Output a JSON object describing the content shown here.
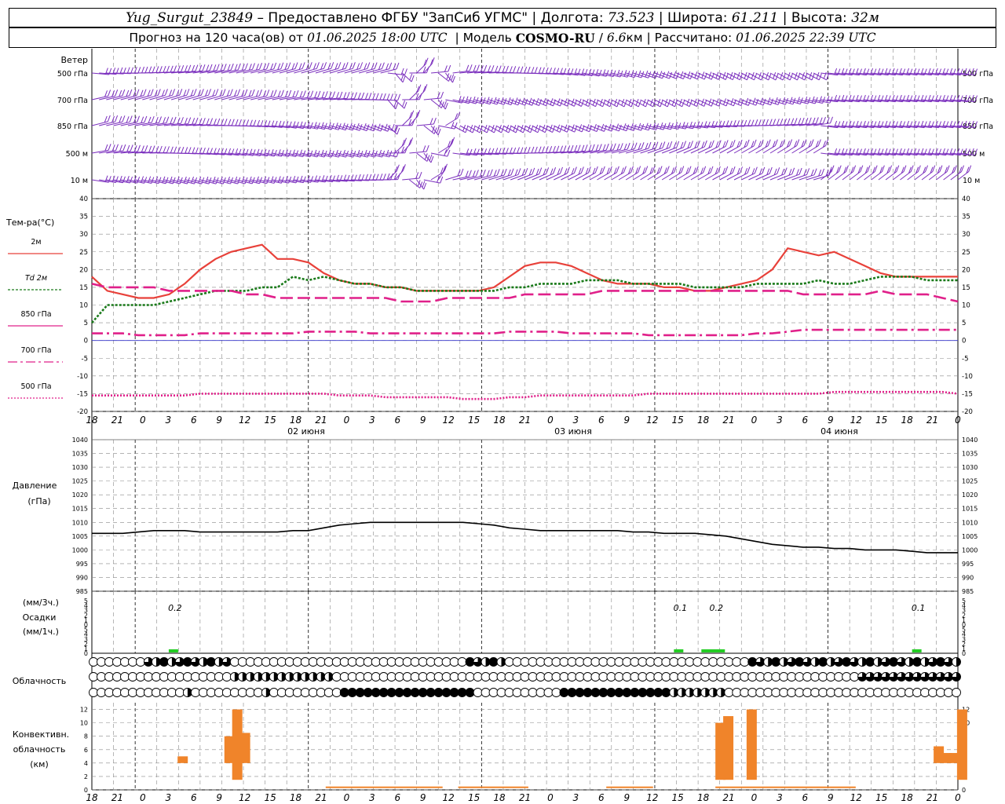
{
  "header": {
    "line1": [
      {
        "t": "Yug_Surgut_23849",
        "s": "it"
      },
      {
        "t": " – Предоставлено ФГБУ \"ЗапСиб УГМС\" | Долгота: ",
        "s": ""
      },
      {
        "t": "73.523",
        "s": "it"
      },
      {
        "t": " | Широта: ",
        "s": ""
      },
      {
        "t": "61.211",
        "s": "it"
      },
      {
        "t": " | Высота: ",
        "s": ""
      },
      {
        "t": "32м",
        "s": "it"
      }
    ],
    "line2": [
      {
        "t": "Прогноз на 120 часа(ов) от ",
        "s": ""
      },
      {
        "t": "01.06.2025 18:00 UTC",
        "s": "it"
      },
      {
        "t": "  | Модель ",
        "s": ""
      },
      {
        "t": "COSMO-RU",
        "s": "b"
      },
      {
        "t": " / ",
        "s": ""
      },
      {
        "t": "6.6",
        "s": "it"
      },
      {
        "t": "км | Рассчитано: ",
        "s": ""
      },
      {
        "t": "01.06.2025 22:39 UTC",
        "s": "it"
      }
    ]
  },
  "wind": {
    "title": "Ветер",
    "levels": [
      "500 гПа",
      "700 гПа",
      "850 гПа",
      "500 м",
      "10  м"
    ],
    "color": "#7b2fbe"
  },
  "temperature": {
    "ylabel": "Тем-ра(°C)",
    "ylim": [
      -20,
      40
    ],
    "yticks": [
      "40",
      "35",
      "30",
      "25",
      "20",
      "15",
      "10",
      "5",
      "0",
      "-5",
      "-10",
      "-15",
      "-20"
    ],
    "legend": [
      {
        "label": "2м",
        "color": "#e8413a",
        "dash": ""
      },
      {
        "label": "Td  2м",
        "color": "#1a7a1a",
        "dash": "3,2"
      },
      {
        "label": "850 гПа",
        "color": "#e0208a",
        "dash": ""
      },
      {
        "label": "700 гПа",
        "color": "#e0208a",
        "dash": "12,4,3,4"
      },
      {
        "label": "500 гПа",
        "color": "#e0208a",
        "dash": "2,2"
      }
    ],
    "day_labels": [
      "02 июня",
      "03 июня",
      "04 июня"
    ]
  },
  "time_ticks": [
    "18",
    "21",
    "0",
    "3",
    "6",
    "9",
    "12",
    "15",
    "18",
    "21",
    "0",
    "3",
    "6",
    "9",
    "12",
    "15",
    "18",
    "21",
    "0",
    "3",
    "6",
    "9",
    "12",
    "15",
    "18",
    "21",
    "0",
    "3",
    "6",
    "9",
    "12",
    "15",
    "18",
    "21",
    "0"
  ],
  "pressure": {
    "ylabel1": "Давление",
    "ylabel2": "(гПа)",
    "ylim": [
      985,
      1040
    ],
    "yticks": [
      "1040",
      "1035",
      "1030",
      "1025",
      "1020",
      "1015",
      "1010",
      "1005",
      "1000",
      "995",
      "990",
      "985"
    ]
  },
  "precip": {
    "ylabel1": "(мм/3ч.)",
    "ylabel2": "Осадки",
    "ylabel3": "(мм/1ч.)",
    "yticks": [
      "5",
      "4",
      "3",
      "2",
      "1",
      "0",
      "5",
      "4",
      "3",
      "2",
      "1",
      "0"
    ],
    "annotations": [
      {
        "text": "0.2",
        "h": 10
      },
      {
        "text": "0.1",
        "h": 80
      },
      {
        "text": "0.2",
        "h": 85
      },
      {
        "text": "0.1",
        "h": 113
      }
    ],
    "color": "#22cc22"
  },
  "cloud": {
    "label": "Облачность"
  },
  "convective": {
    "ylabel1": "Конвективн.",
    "ylabel2": "облачность",
    "ylabel3": "(км)",
    "yticks": [
      "12",
      "10",
      "8",
      "6",
      "4",
      "2",
      "0"
    ],
    "color": "#f0842a"
  },
  "chart_data": {
    "type": "line",
    "x_hours_labels": "18 UTC 01.06 to 18 UTC 05.06 style axis (hour of day)",
    "series": [
      {
        "name": "2м",
        "unit": "°C",
        "values": [
          18,
          14,
          13,
          12,
          12,
          13,
          16,
          20,
          23,
          25,
          26,
          27,
          23,
          23,
          22,
          19,
          17,
          16,
          16,
          15,
          15,
          14,
          14,
          14,
          14,
          14,
          15,
          18,
          21,
          22,
          22,
          21,
          19,
          17,
          16,
          16,
          16,
          15,
          15,
          14,
          14,
          15,
          16,
          17,
          20,
          26,
          25,
          24,
          25,
          23,
          21,
          19,
          18,
          18,
          18,
          18,
          18
        ]
      },
      {
        "name": "Td  2м",
        "unit": "°C",
        "values": [
          5,
          10,
          10,
          10,
          10,
          11,
          12,
          13,
          14,
          14,
          14,
          15,
          15,
          18,
          17,
          18,
          17,
          16,
          16,
          15,
          15,
          14,
          14,
          14,
          14,
          14,
          14,
          15,
          15,
          16,
          16,
          16,
          17,
          17,
          17,
          16,
          16,
          16,
          16,
          15,
          15,
          15,
          15,
          16,
          16,
          16,
          16,
          17,
          16,
          16,
          17,
          18,
          18,
          18,
          17,
          17,
          17
        ]
      },
      {
        "name": "850 гПа",
        "unit": "°C",
        "values": [
          16,
          15,
          15,
          15,
          15,
          14,
          14,
          14,
          14,
          14,
          13,
          13,
          12,
          12,
          12,
          12,
          12,
          12,
          12,
          12,
          11,
          11,
          11,
          12,
          12,
          12,
          12,
          12,
          13,
          13,
          13,
          13,
          13,
          14,
          14,
          14,
          14,
          14,
          14,
          14,
          14,
          14,
          14,
          14,
          14,
          14,
          13,
          13,
          13,
          13,
          13,
          14,
          13,
          13,
          13,
          12,
          11
        ]
      },
      {
        "name": "700 гПа",
        "unit": "°C",
        "values": [
          2,
          2,
          2,
          1.5,
          1.5,
          1.5,
          1.5,
          2,
          2,
          2,
          2,
          2,
          2,
          2,
          2.5,
          2.5,
          2.5,
          2.5,
          2,
          2,
          2,
          2,
          2,
          2,
          2,
          2,
          2,
          2.5,
          2.5,
          2.5,
          2.5,
          2,
          2,
          2,
          2,
          2,
          1.5,
          1.5,
          1.5,
          1.5,
          1.5,
          1.5,
          1.5,
          2,
          2,
          2.5,
          3,
          3,
          3,
          3,
          3,
          3,
          3,
          3,
          3,
          3,
          3
        ]
      },
      {
        "name": "500 гПа",
        "unit": "°C",
        "values": [
          -15.5,
          -15.5,
          -15.5,
          -15.5,
          -15.5,
          -15.5,
          -15.5,
          -15,
          -15,
          -15,
          -15,
          -15,
          -15,
          -15,
          -15,
          -15,
          -15.5,
          -15.5,
          -15.5,
          -16,
          -16,
          -16,
          -16,
          -16,
          -16.5,
          -16.5,
          -16.5,
          -16,
          -16,
          -15.5,
          -15.5,
          -15.5,
          -15.5,
          -15.5,
          -15.5,
          -15.5,
          -15,
          -15,
          -15,
          -15,
          -15,
          -15,
          -15,
          -15,
          -15,
          -15,
          -15,
          -15,
          -14.5,
          -14.5,
          -14.5,
          -14.5,
          -14.5,
          -14.5,
          -14.5,
          -14.5,
          -15
        ]
      },
      {
        "name": "pressure",
        "unit": "гПа",
        "values": [
          1006,
          1006,
          1006,
          1006.5,
          1007,
          1007,
          1007,
          1006.5,
          1006.5,
          1006.5,
          1006.5,
          1006.5,
          1006.5,
          1007,
          1007,
          1008,
          1009,
          1009.5,
          1010,
          1010,
          1010,
          1010,
          1010,
          1010,
          1010,
          1009.5,
          1009,
          1008,
          1007.5,
          1007,
          1007,
          1007,
          1007,
          1007,
          1007,
          1006.5,
          1006.5,
          1006,
          1006,
          1006,
          1005.5,
          1005,
          1004,
          1003,
          1002,
          1001.5,
          1001,
          1001,
          1000.5,
          1000.5,
          1000,
          1000,
          1000,
          999.5,
          999,
          999,
          999
        ]
      }
    ],
    "ylim": [
      -20,
      40
    ]
  }
}
